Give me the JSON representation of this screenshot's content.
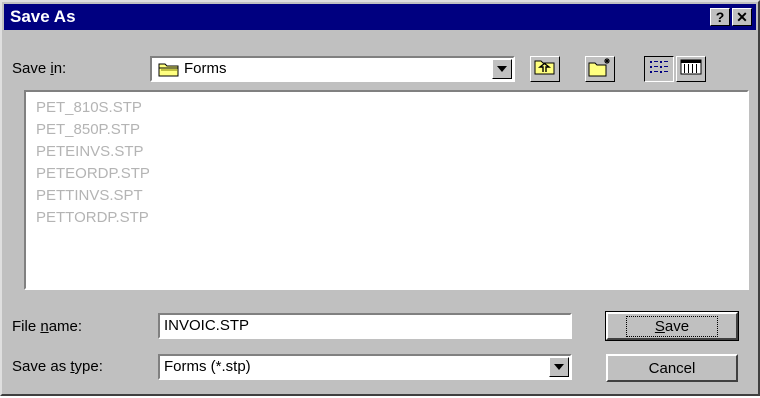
{
  "dialog": {
    "title": "Save As",
    "help_label": "?",
    "close_label": "✕"
  },
  "save_in": {
    "label_pre": "Save ",
    "label_key": "i",
    "label_post": "n:",
    "value": "Forms",
    "folder_icon": "folder-icon"
  },
  "toolbar": {
    "icons": [
      "up-one-level-icon",
      "create-new-folder-icon",
      "list-view-icon",
      "details-view-icon"
    ]
  },
  "files": [
    "PET_810S.STP",
    "PET_850P.STP",
    "PETEINVS.STP",
    "PETEORDP.STP",
    "PETTINVS.SPT",
    "PETTORDP.STP"
  ],
  "file_name": {
    "label_pre": "File ",
    "label_key": "n",
    "label_post": "ame:",
    "value": "INVOIC.STP"
  },
  "save_as_type": {
    "label_pre": "Save as ",
    "label_key": "t",
    "label_post": "ype:",
    "value": "Forms (*.stp)"
  },
  "buttons": {
    "save_key": "S",
    "save_rest": "ave",
    "cancel_label": "Cancel"
  },
  "colors": {
    "title_bar": "#000080",
    "face": "#c0c0c0",
    "file_text": "#b4b4b4"
  }
}
